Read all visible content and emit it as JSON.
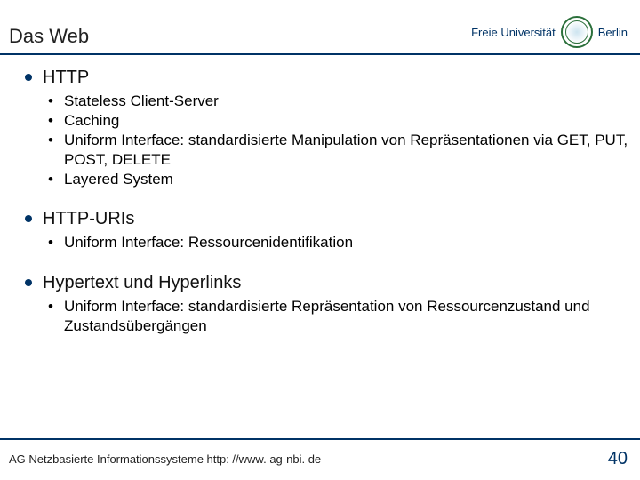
{
  "header": {
    "title": "Das Web",
    "logo": {
      "prefix": "Freie",
      "main": "Universität",
      "city": "Berlin"
    }
  },
  "bullets": [
    {
      "label": "HTTP",
      "items": [
        "Stateless Client-Server",
        "Caching",
        "Uniform Interface: standardisierte Manipulation von Repräsentationen via GET, PUT, POST, DELETE",
        "Layered System"
      ]
    },
    {
      "label": "HTTP-URIs",
      "items": [
        "Uniform Interface: Ressourcenidentifikation"
      ]
    },
    {
      "label": "Hypertext und Hyperlinks",
      "items": [
        "Uniform Interface: standardisierte Repräsentation von Ressourcenzustand und Zustandsübergängen"
      ]
    }
  ],
  "footer": {
    "text": "AG Netzbasierte Informationssysteme http: //www. ag-nbi. de",
    "page": "40"
  }
}
